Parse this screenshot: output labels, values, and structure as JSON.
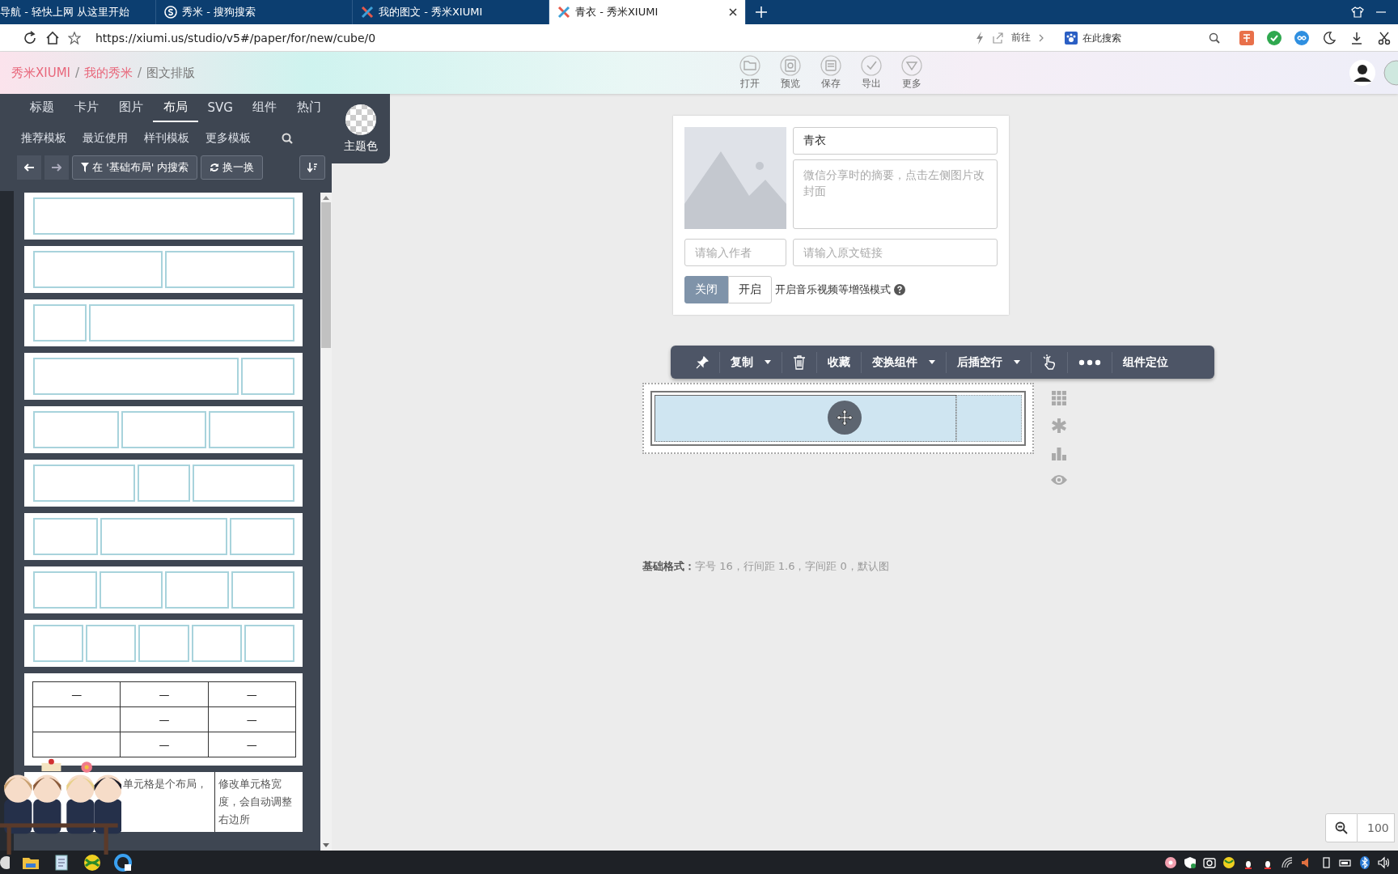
{
  "browser": {
    "tabs": [
      {
        "title": "导航 - 轻快上网 从这里开始",
        "selected": false,
        "kind": "plain"
      },
      {
        "title": "秀米 - 搜狗搜索",
        "selected": false,
        "kind": "search"
      },
      {
        "title": "我的图文 - 秀米XIUMI",
        "selected": false,
        "kind": "site"
      },
      {
        "title": "青衣 - 秀米XIUMI",
        "selected": true,
        "kind": "site"
      }
    ],
    "url": "https://xiumi.us/studio/v5#/paper/for/new/cube/0",
    "go_label": "前往",
    "search": {
      "placeholder": "在此搜索"
    }
  },
  "header": {
    "breadcrumb": [
      {
        "label": "秀米XIUMI",
        "link": true,
        "separator": "/"
      },
      {
        "label": "我的秀米",
        "link": true,
        "separator": "/"
      },
      {
        "label": "图文排版",
        "link": false
      }
    ],
    "actions": [
      {
        "label": "打开",
        "kind": "folder"
      },
      {
        "label": "预览",
        "kind": "preview"
      },
      {
        "label": "保存",
        "kind": "save"
      },
      {
        "label": "导出",
        "kind": "check"
      },
      {
        "label": "更多",
        "kind": "more"
      }
    ]
  },
  "panel": {
    "tabs": [
      {
        "label": "标题",
        "selected": false
      },
      {
        "label": "卡片",
        "selected": false
      },
      {
        "label": "图片",
        "selected": false
      },
      {
        "label": "布局",
        "selected": true
      },
      {
        "label": "SVG",
        "selected": false
      },
      {
        "label": "组件",
        "selected": false
      },
      {
        "label": "热门",
        "selected": false
      }
    ],
    "subtabs": [
      "推荐模板",
      "最近使用",
      "样刊模板",
      "更多模板"
    ],
    "theme_label": "主题色",
    "filter_button": "在 '基础布局' 内搜索",
    "shuffle_button": "换一换",
    "templates": [
      {
        "kind": "boxes",
        "columns": [
          {
            "kind": "wide"
          }
        ]
      },
      {
        "kind": "boxes",
        "columns": [
          {
            "kind": "medium"
          },
          {
            "kind": "medium"
          }
        ]
      },
      {
        "kind": "boxes",
        "columns": [
          {
            "kind": "narrow"
          },
          {
            "kind": "wide"
          }
        ]
      },
      {
        "kind": "boxes",
        "columns": [
          {
            "kind": "wide"
          },
          {
            "kind": "narrow"
          }
        ]
      },
      {
        "kind": "boxes",
        "columns": [
          {
            "kind": "medium"
          },
          {
            "kind": "medium"
          },
          {
            "kind": "medium"
          }
        ]
      },
      {
        "kind": "boxes",
        "columns": [
          {
            "kind": "medium"
          },
          {
            "kind": "narrow"
          },
          {
            "kind": "medium"
          }
        ]
      },
      {
        "kind": "boxes",
        "columns": [
          {
            "kind": "narrow"
          },
          {
            "kind": "medium"
          },
          {
            "kind": "narrow"
          }
        ]
      },
      {
        "kind": "boxes",
        "columns": [
          {
            "kind": "narrow"
          },
          {
            "kind": "narrow"
          },
          {
            "kind": "narrow"
          },
          {
            "kind": "narrow"
          }
        ]
      },
      {
        "kind": "boxes",
        "columns": [
          {
            "kind": "narrow"
          },
          {
            "kind": "narrow"
          },
          {
            "kind": "narrow"
          },
          {
            "kind": "narrow"
          },
          {
            "kind": "narrow"
          }
        ]
      },
      {
        "kind": "table",
        "rows": [
          [
            "—",
            "—",
            "—"
          ],
          [
            "",
            "—",
            "—"
          ],
          [
            "",
            "—",
            "—"
          ]
        ]
      },
      {
        "kind": "text",
        "cells": [
          "单元格是个布局，",
          "修改单元格宽度，会自动调整右边所"
        ]
      }
    ]
  },
  "card": {
    "title_value": "青衣",
    "summary_placeholder": "微信分享时的摘要，点击左侧图片改封面",
    "author_placeholder": "请输入作者",
    "link_placeholder": "请输入原文链接",
    "mode_options": [
      {
        "label": "关闭",
        "selected": true
      },
      {
        "label": "开启",
        "selected": false
      }
    ],
    "mode_label": "开启音乐视频等增强模式"
  },
  "toolbar": [
    {
      "kind": "pin"
    },
    {
      "kind": "dropdown",
      "label": "复制"
    },
    {
      "kind": "trash"
    },
    {
      "kind": "text",
      "label": "收藏"
    },
    {
      "kind": "dropdown",
      "label": "变换组件"
    },
    {
      "kind": "dropdown",
      "label": "后插空行"
    },
    {
      "kind": "pointer"
    },
    {
      "kind": "more"
    },
    {
      "kind": "text",
      "label": "组件定位"
    }
  ],
  "format_note": "**基础格式：**字号 16，行间距 1.6，字间距 0，默认图",
  "zoom": {
    "value": "100"
  }
}
